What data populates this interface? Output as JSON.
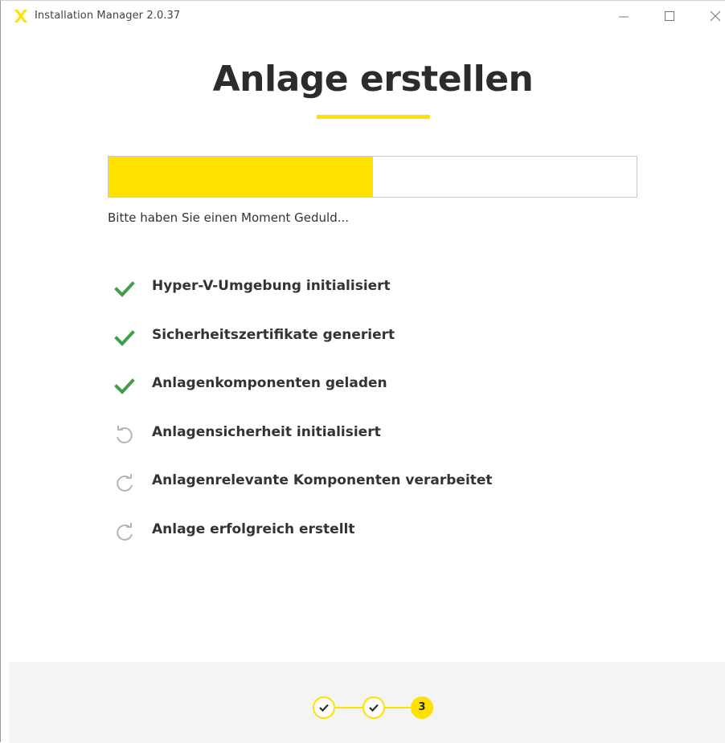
{
  "window": {
    "title": "Installation Manager 2.0.37",
    "logo_icon": "x-logo-icon",
    "controls": [
      "minimize-icon",
      "maximize-icon",
      "close-icon"
    ]
  },
  "header": {
    "title": "Anlage erstellen"
  },
  "progress": {
    "percent": 50,
    "message": "Bitte haben Sie einen Moment Geduld..."
  },
  "steps": [
    {
      "label": "Hyper-V-Umgebung initialisiert",
      "status": "done",
      "icon": "checkmark-icon"
    },
    {
      "label": "Sicherheitszertifikate generiert",
      "status": "done",
      "icon": "checkmark-icon"
    },
    {
      "label": "Anlagenkomponenten geladen",
      "status": "done",
      "icon": "checkmark-icon"
    },
    {
      "label": "Anlagensicherheit initialisiert",
      "status": "in-progress",
      "icon": "refresh-icon"
    },
    {
      "label": "Anlagenrelevante Komponenten verarbeitet",
      "status": "pending",
      "icon": "refresh-icon"
    },
    {
      "label": "Anlage erfolgreich erstellt",
      "status": "pending",
      "icon": "refresh-icon"
    }
  ],
  "wizard": {
    "steps": [
      {
        "state": "done",
        "icon": "checkmark-icon"
      },
      {
        "state": "done",
        "icon": "checkmark-icon"
      },
      {
        "state": "current",
        "label": "3"
      }
    ]
  },
  "colors": {
    "accent": "#ffe100",
    "success": "#3f9e4a",
    "pending": "#b5b5b5",
    "text": "#333333"
  }
}
